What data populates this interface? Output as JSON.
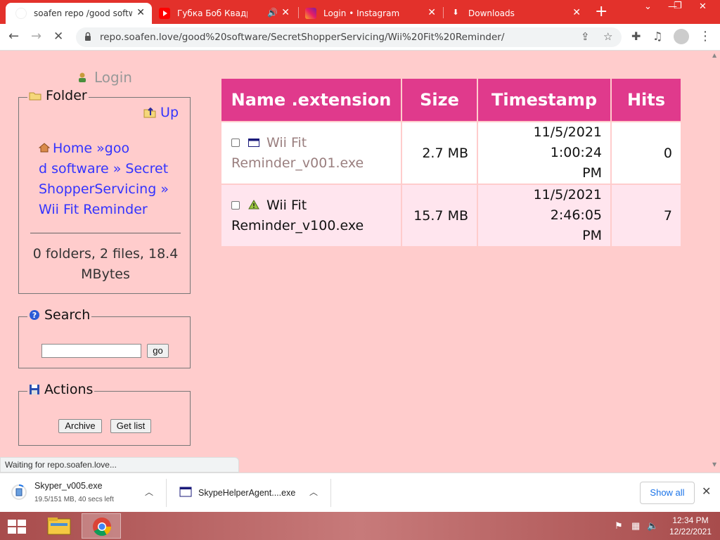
{
  "browser": {
    "tabs": [
      {
        "title": "soafen repo /good softwar",
        "active": true
      },
      {
        "title": "Губка Боб Квадратны",
        "active": false
      },
      {
        "title": "Login • Instagram",
        "active": false
      },
      {
        "title": "Downloads",
        "active": false
      }
    ],
    "url": "repo.soafen.love/good%20software/SecretShopperServicing/Wii%20Fit%20Reminder/",
    "status": "Waiting for repo.soafen.love..."
  },
  "sidebar": {
    "login": "Login",
    "folder": {
      "legend": "Folder",
      "up": "Up",
      "breadcrumb": {
        "home": "Home",
        "sep": "»",
        "part1a": "goo",
        "part1b": "d software",
        "part2a": "Secret",
        "part2b": "ShopperServicing",
        "part3": "Wii Fit Reminder"
      },
      "summary": "0 folders, 2 files, 18.4 MBytes"
    },
    "search": {
      "legend": "Search",
      "go": "go",
      "value": ""
    },
    "actions": {
      "legend": "Actions",
      "archive": "Archive",
      "getlist": "Get list"
    }
  },
  "table": {
    "headers": {
      "name": "Name .extension",
      "size": "Size",
      "timestamp": "Timestamp",
      "hits": "Hits"
    },
    "rows": [
      {
        "name_a": "Wii Fit",
        "name_b": "Reminder_v001.exe",
        "size": "2.7 MB",
        "ts_a": "11/5/2021 1:00:24",
        "ts_b": "PM",
        "hits": "0"
      },
      {
        "name_a": "Wii Fit",
        "name_b": "Reminder_v100.exe",
        "size": "15.7 MB",
        "ts_a": "11/5/2021 2:46:05",
        "ts_b": "PM",
        "hits": "7"
      }
    ]
  },
  "downloads": {
    "items": [
      {
        "name": "Skyper_v005.exe",
        "progress": "19.5/151 MB, 40 secs left"
      },
      {
        "name": "SkypeHelperAgent....exe"
      }
    ],
    "show_all": "Show all"
  },
  "taskbar": {
    "time": "12:34 PM",
    "date": "12/22/2021"
  },
  "colors": {
    "page_bg": "#ffcccc",
    "header_bg": "#e03a8c",
    "link": "#3333ff",
    "tabstrip": "#e3312b"
  }
}
